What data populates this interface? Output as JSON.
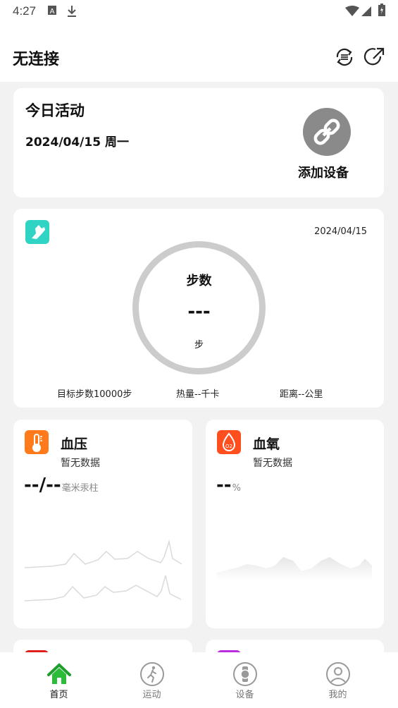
{
  "status_bar": {
    "time": "4:27"
  },
  "app_bar": {
    "title": "无连接"
  },
  "today": {
    "title": "今日活动",
    "date": "2024/04/15 周一",
    "add_device_label": "添加设备"
  },
  "steps": {
    "date": "2024/04/15",
    "ring_title": "步数",
    "value": "---",
    "unit": "步",
    "goal": "目标步数10000步",
    "calories": "热量--千卡",
    "distance": "距离--公里"
  },
  "blood_pressure": {
    "title": "血压",
    "status": "暂无数据",
    "value": "--/--",
    "unit": "毫米汞柱",
    "icon_color": "#ff7a1a"
  },
  "blood_oxygen": {
    "title": "血氧",
    "status": "暂无数据",
    "value": "--",
    "unit": "%",
    "icon_color": "#ff4f1f"
  },
  "nav": [
    {
      "label": "首页",
      "icon": "home-icon",
      "active": true
    },
    {
      "label": "运动",
      "icon": "running-icon",
      "active": false
    },
    {
      "label": "设备",
      "icon": "watch-icon",
      "active": false
    },
    {
      "label": "我的",
      "icon": "profile-icon",
      "active": false
    }
  ],
  "colors": {
    "accent": "#2dbb3a",
    "shoe_badge": "#2fd4c4",
    "ring": "#cccccc",
    "purple_card": "#b92ce0",
    "red_card": "#e0201e"
  }
}
